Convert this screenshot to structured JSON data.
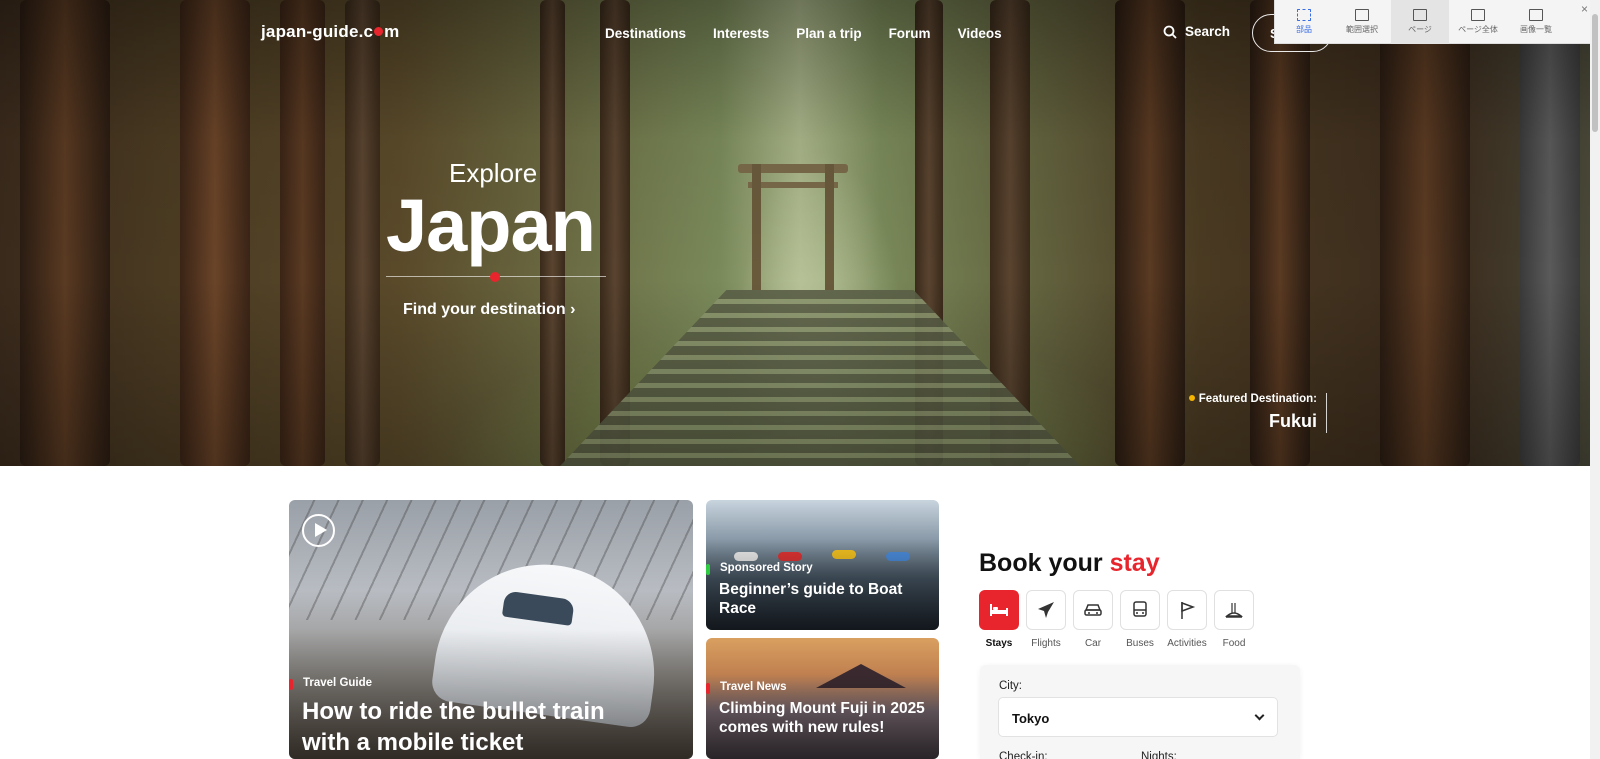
{
  "header": {
    "logo_text_a": "japan-guide.c",
    "logo_text_b": "m",
    "nav": [
      "Destinations",
      "Interests",
      "Plan a trip",
      "Forum",
      "Videos"
    ],
    "search_label": "Search",
    "signin_label": "S"
  },
  "overlay_toolbar": {
    "items": [
      "部品",
      "範囲選択",
      "ページ",
      "ページ全体",
      "画像一覧"
    ],
    "close": "×"
  },
  "hero": {
    "explore": "Explore",
    "title": "Japan",
    "cta": "Find your destination ›",
    "featured_label": "Featured Destination:",
    "featured_name": "Fukui"
  },
  "cards": {
    "main": {
      "tag": "Travel Guide",
      "title": "How to ride the bullet train with a mobile ticket"
    },
    "sponsored": {
      "tag": "Sponsored Story",
      "title": "Beginner’s guide to Boat Race"
    },
    "news": {
      "tag": "Travel News",
      "title": "Climbing Mount Fuji in 2025 comes with new rules!"
    }
  },
  "booking": {
    "title_a": "Book your ",
    "title_b": "stay",
    "categories": [
      "Stays",
      "Flights",
      "Car",
      "Buses",
      "Activities",
      "Food"
    ],
    "city_label": "City:",
    "city_value": "Tokyo",
    "checkin_label": "Check-in:",
    "nights_label": "Nights:"
  },
  "colors": {
    "accent": "#e8252d",
    "featured_dot": "#f4b400",
    "sponsored_mark": "#2ecc40"
  }
}
